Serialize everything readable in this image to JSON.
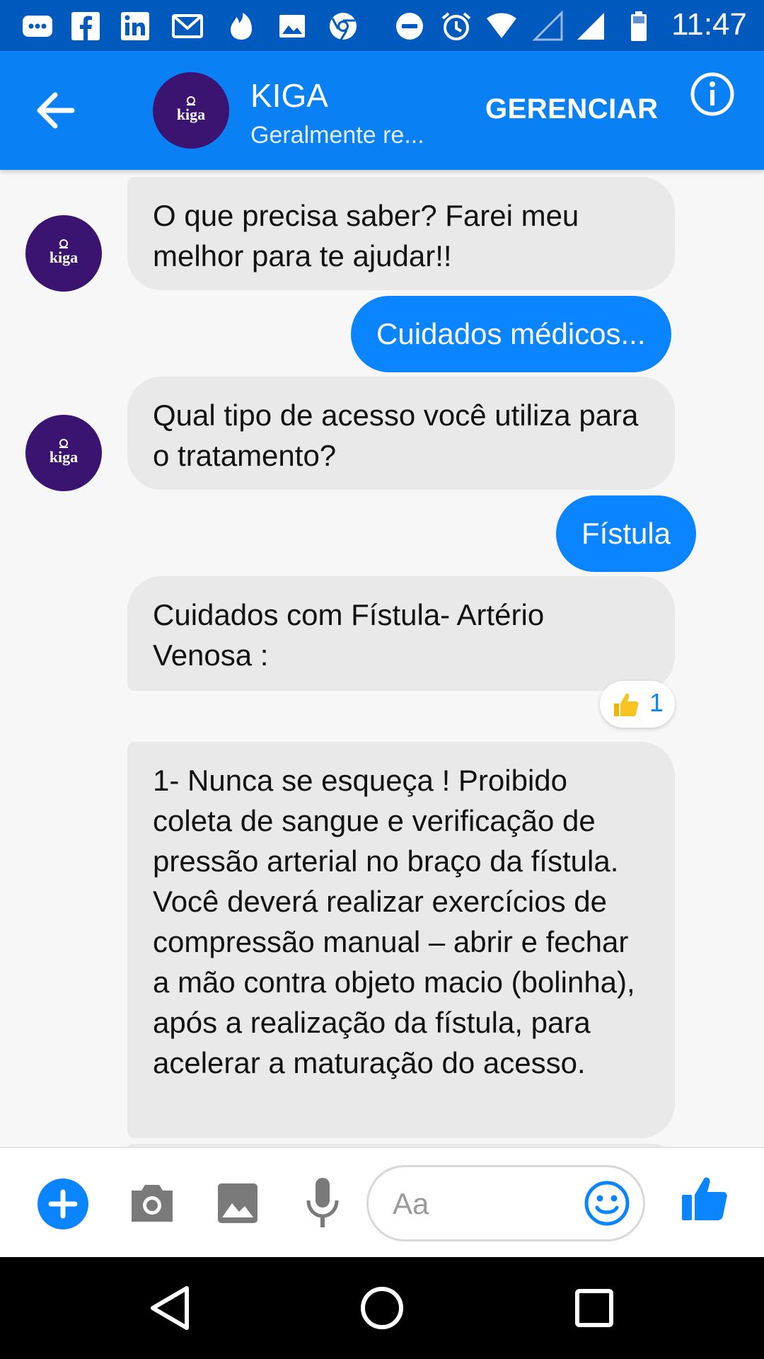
{
  "status_bar": {
    "time": "11:47",
    "icons": [
      "messenger-icon",
      "facebook-icon",
      "linkedin-icon",
      "gmail-icon",
      "tinder-icon",
      "gallery-icon",
      "chrome-icon",
      "do-not-disturb-icon",
      "alarm-icon",
      "wifi-icon",
      "signal-empty-icon",
      "signal-icon",
      "battery-icon"
    ]
  },
  "header": {
    "title": "KIGA",
    "subtitle": "Geralmente re...",
    "manage_label": "GERENCIAR",
    "avatar_text": "kiga"
  },
  "messages": [
    {
      "side": "in",
      "text": "O que precisa saber?  Farei meu melhor para te ajudar!!",
      "avatar_text": "kiga"
    },
    {
      "side": "out",
      "text": "Cuidados médicos..."
    },
    {
      "side": "in",
      "text": "Qual tipo de acesso você utiliza para o tratamento?",
      "avatar_text": "kiga"
    },
    {
      "side": "out",
      "text": "Fístula"
    },
    {
      "side": "in",
      "text": "Cuidados com Fístula- Artério Venosa :",
      "reaction": {
        "emoji": "thumbs-up",
        "count": "1"
      }
    },
    {
      "side": "in",
      "text": "1- Nunca se esqueça ! Proibido coleta de sangue e verificação de pressão arterial no braço da fístula.  Você deverá  realizar exercícios de compressão manual – abrir e fechar a mão contra objeto macio (bolinha), após a realização da fístula, para acelerar a maturação do acesso."
    }
  ],
  "composer": {
    "placeholder": "Aa"
  },
  "colors": {
    "accent": "#0a84ff",
    "header": "#0a80f5",
    "status_bar": "#0059bd",
    "avatar": "#3b1370",
    "incoming_bubble": "#e9e9e9"
  }
}
